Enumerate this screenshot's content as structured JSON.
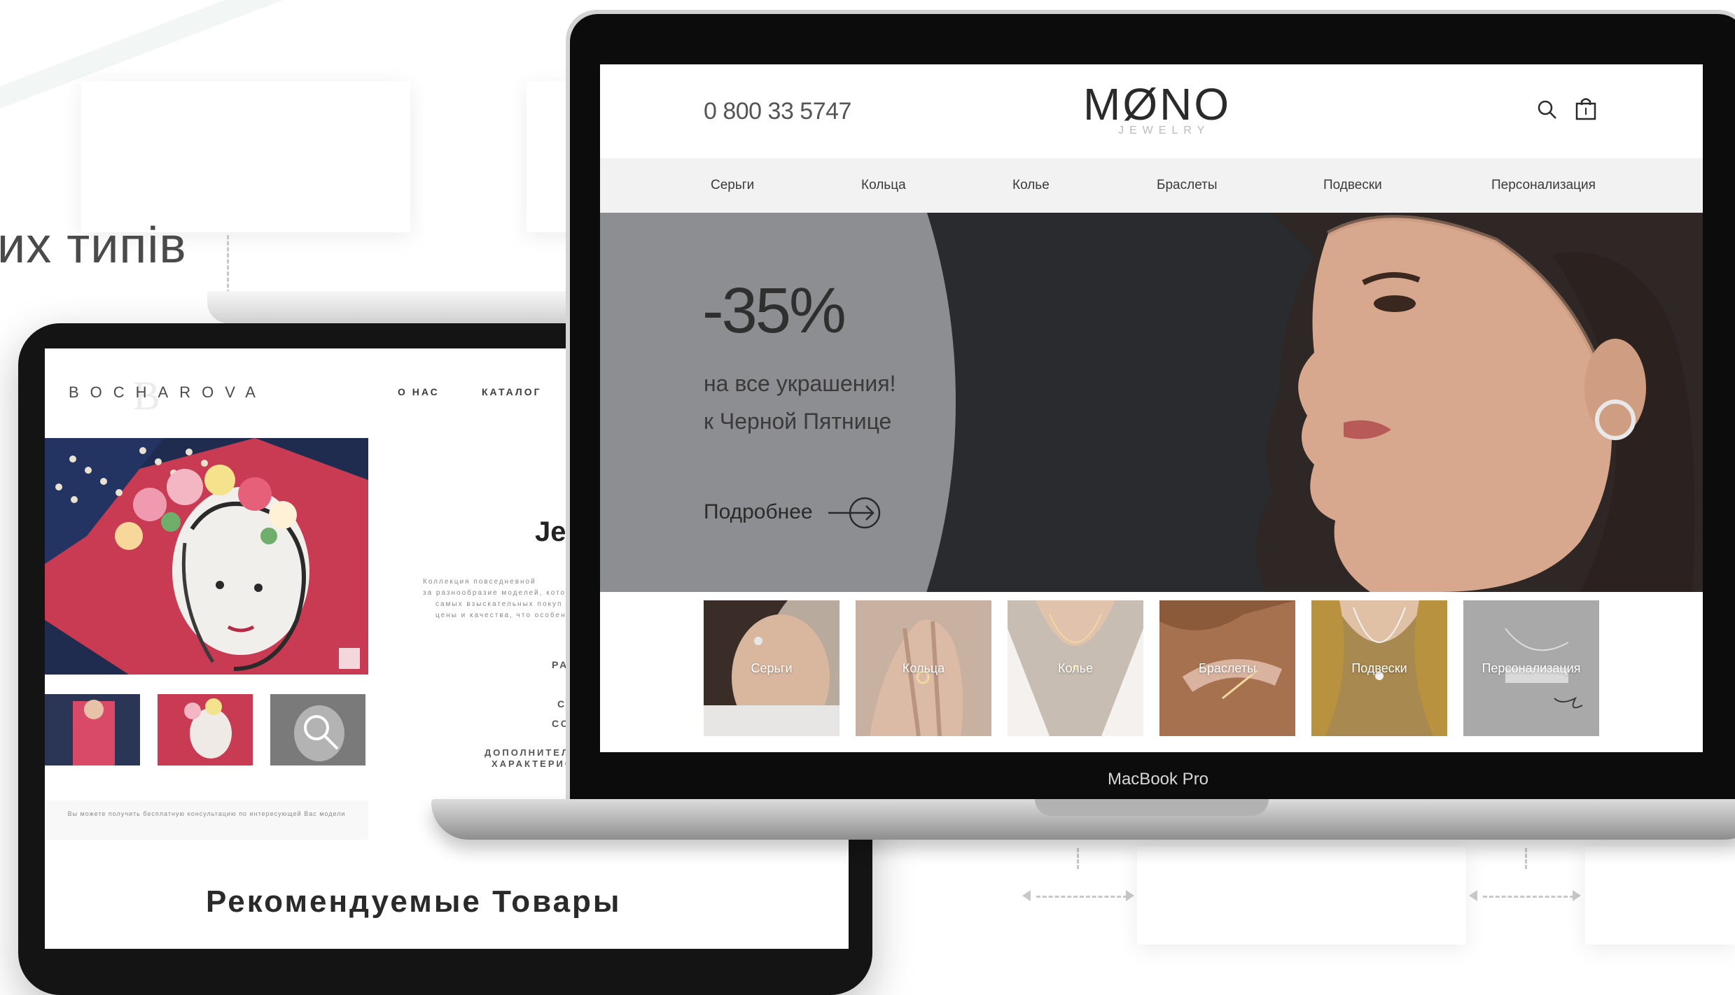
{
  "background": {
    "partial_heading": "их типів"
  },
  "tablet_site": {
    "logo": "BOCHAROVA",
    "logo_mark": "B",
    "nav": [
      {
        "label": "О НАС"
      },
      {
        "label": "КАТАЛОГ"
      }
    ],
    "partial_heading": "Je",
    "description_lines": [
      "Коллекция повседневной ",
      "за разнообразие моделей, кото",
      "самых взыскательных покуп",
      "цены и качества, что особен"
    ],
    "detail_labels": [
      "РА",
      "С",
      "СО"
    ],
    "extra_label_lines": [
      "ДОПОЛНИТЕЛ",
      "ХАРАКТЕРИС"
    ],
    "consult_text": "Вы можете получить бесплатную консультацию по интересующей Вас модели",
    "recommended_title": "Рекомендуемые Товары"
  },
  "laptop": {
    "model_label": "MacBook Pro"
  },
  "mono_site": {
    "phone": "0 800 33 5747",
    "logo": "MØNO",
    "logo_sub": "JEWELRY",
    "icons": {
      "search": "search-icon",
      "bag": "shopping-bag-icon"
    },
    "nav": [
      {
        "label": "Серьги"
      },
      {
        "label": "Кольца"
      },
      {
        "label": "Колье"
      },
      {
        "label": "Браслеты"
      },
      {
        "label": "Подвески"
      },
      {
        "label": "Персонализация"
      }
    ],
    "hero": {
      "discount": "-35%",
      "line1": "на все украшения!",
      "line2": "к Черной Пятнице",
      "cta_label": "Подробнее"
    },
    "categories": [
      {
        "label": "Серьги",
        "color": "#b9aa9e"
      },
      {
        "label": "Кольца",
        "color": "#c8b1a1"
      },
      {
        "label": "Колье",
        "color": "#c7bdb2"
      },
      {
        "label": "Браслеты",
        "color": "#8a5a3b"
      },
      {
        "label": "Подвески",
        "color": "#a88950"
      },
      {
        "label": "Персонализация",
        "color": "#a9a9a9"
      }
    ],
    "colors": {
      "hero_dark": "#2a2b2f",
      "hero_gray": "#8d8e92",
      "nav_bg": "#f2f2f2"
    }
  }
}
